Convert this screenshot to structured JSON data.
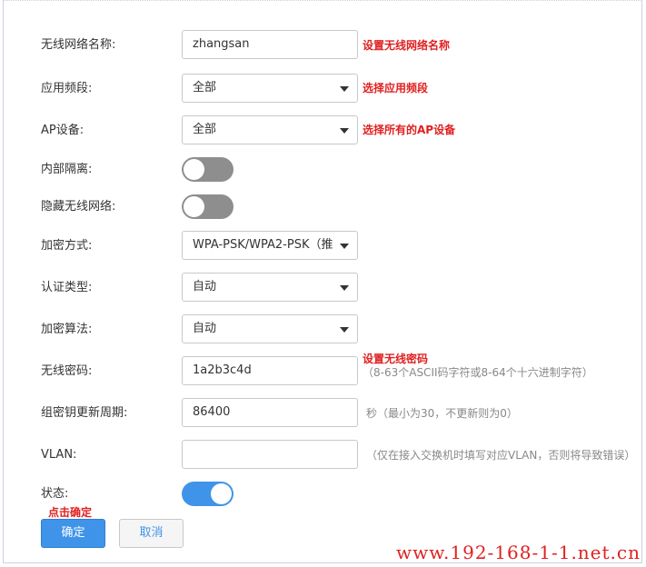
{
  "form": {
    "ssid": {
      "label": "无线网络名称:",
      "value": "zhangsan",
      "annotation": "设置无线网络名称"
    },
    "band": {
      "label": "应用频段:",
      "value": "全部",
      "annotation": "选择应用频段"
    },
    "ap": {
      "label": "AP设备:",
      "value": "全部",
      "annotation": "选择所有的AP设备"
    },
    "isolation": {
      "label": "内部隔离:",
      "on": false
    },
    "hide_ssid": {
      "label": "隐藏无线网络:",
      "on": false
    },
    "encryption": {
      "label": "加密方式:",
      "value": "WPA-PSK/WPA2-PSK（推"
    },
    "auth": {
      "label": "认证类型:",
      "value": "自动"
    },
    "cipher": {
      "label": "加密算法:",
      "value": "自动"
    },
    "password": {
      "label": "无线密码:",
      "value": "1a2b3c4d",
      "annotation": "设置无线密码",
      "hint": "（8-63个ASCII码字符或8-64个十六进制字符）"
    },
    "rekey": {
      "label": "组密钥更新周期:",
      "value": "86400",
      "hint": "秒（最小为30，不更新则为0）"
    },
    "vlan": {
      "label": "VLAN:",
      "value": "",
      "hint": "（仅在接入交换机时填写对应VLAN，否则将导致错误）"
    },
    "status": {
      "label": "状态:",
      "on": true
    }
  },
  "buttons": {
    "ok_annotation": "点击确定",
    "ok_label": "确定",
    "cancel_label": "取消"
  },
  "watermark": "www.192-168-1-1.net.cn",
  "colors": {
    "accent": "#3f94e9",
    "annotation": "#e02020",
    "toggle_off": "#8e8e8e"
  }
}
